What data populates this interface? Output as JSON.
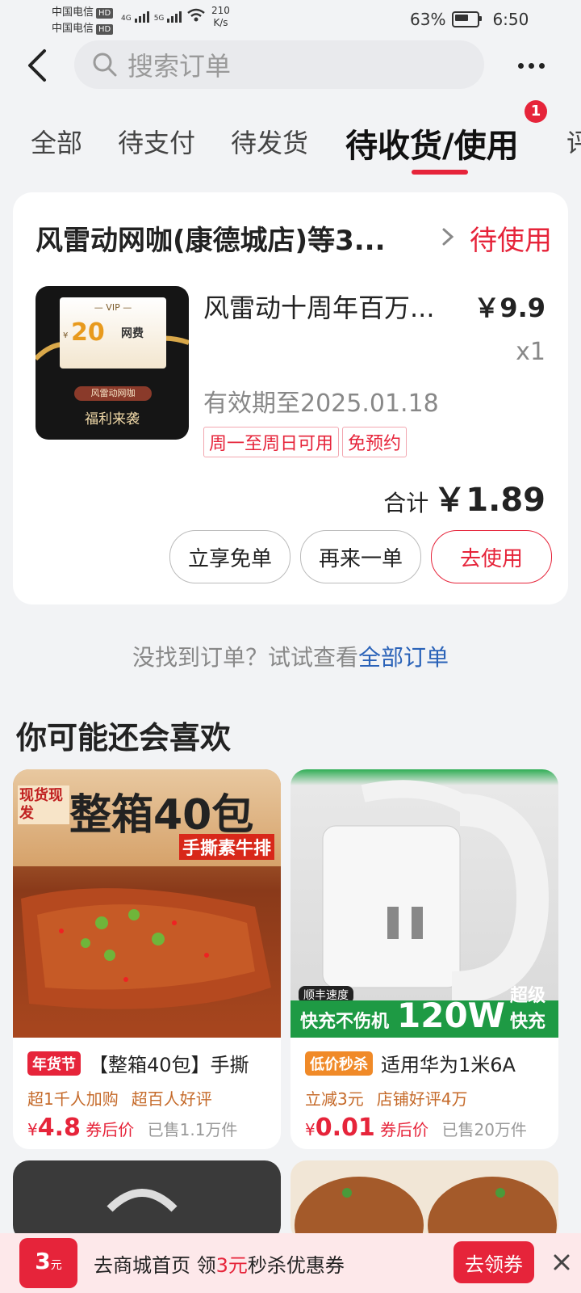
{
  "status_bar": {
    "carrier1": "中国电信",
    "carrier2": "中国电信",
    "hd": "HD",
    "net1": "4G",
    "net2": "5G",
    "speed_value": "210",
    "speed_unit": "K/s",
    "battery": "63%",
    "time": "6:50"
  },
  "header": {
    "search_placeholder": "搜索订单"
  },
  "tabs": {
    "items": [
      "全部",
      "待支付",
      "待发货",
      "待收货/使用",
      "评"
    ],
    "active_index": 3,
    "badge": "1"
  },
  "order": {
    "shop_name": "风雷动网咖(康德城店)等3...",
    "status": "待使用",
    "thumb": {
      "vip": "— VIP —",
      "amount": "20",
      "yen": "¥",
      "type": "网费",
      "tag": "风雷动网咖",
      "promo": "福利来袭"
    },
    "product_title": "风雷动十周年百万...",
    "price": "￥9.9",
    "qty": "x1",
    "expiry": "有效期至2025.01.18",
    "tags": [
      "周一至周日可用",
      "免预约"
    ],
    "total_label": "合计",
    "total_value": "￥1.89",
    "buttons": {
      "free": "立享免单",
      "again": "再来一单",
      "use": "去使用"
    }
  },
  "hint": {
    "text": "没找到订单？试试查看",
    "link": "全部订单"
  },
  "recommend": {
    "title": "你可能还会喜欢",
    "products": [
      {
        "badge": "年货节",
        "badge_color": "#e6243a",
        "title": "【整箱40包】手撕",
        "sub1": "超1千人加购",
        "sub2": "超百人好评",
        "yen": "¥",
        "price": "4.8",
        "price_suffix": "券后价",
        "sold": "已售1.1万件",
        "img_headline": "整箱40包",
        "img_sub": "手撕素牛排",
        "img_corner": "现货现发"
      },
      {
        "badge": "低价秒杀",
        "badge_color": "#f08a28",
        "title": "适用华为1米6A",
        "sub1": "立减3元",
        "sub2": "店铺好评4万",
        "yen": "¥",
        "price": "0.01",
        "price_suffix": "券后价",
        "sold": "已售20万件",
        "img_tag": "顺丰速度",
        "img_left": "快充不伤机",
        "img_big": "120W",
        "img_right1": "超级",
        "img_right2": "快充"
      }
    ]
  },
  "coupon_bar": {
    "chip_amount": "3",
    "chip_unit": "元",
    "text_pre": "去商城首页 领",
    "text_em": "3元",
    "text_post": "秒杀优惠券",
    "button": "去领券"
  }
}
